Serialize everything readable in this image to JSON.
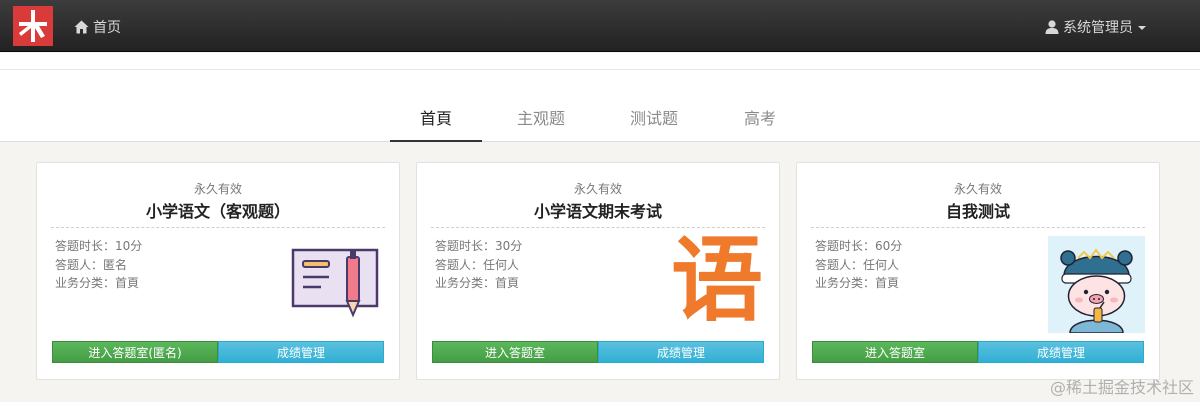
{
  "navbar": {
    "home_label": "首页",
    "user_label": "系统管理员",
    "icons": {
      "logo": "brand-logo",
      "home": "home-icon",
      "user": "user-icon",
      "caret": "caret-down-icon"
    }
  },
  "tabs": [
    {
      "label": "首頁",
      "active": true
    },
    {
      "label": "主观题",
      "active": false
    },
    {
      "label": "测试题",
      "active": false
    },
    {
      "label": "高考",
      "active": false
    }
  ],
  "cards": [
    {
      "validity": "永久有效",
      "title": "小学语文（客观题）",
      "info": [
        "答题时长：10分",
        "答题人：匿名",
        "业务分类：首頁"
      ],
      "enter_label": "进入答题室(匿名)",
      "score_label": "成绩管理",
      "art": "notebook-pen-icon"
    },
    {
      "validity": "永久有效",
      "title": "小学语文期末考试",
      "info": [
        "答题时长：30分",
        "答题人：任何人",
        "业务分类：首頁"
      ],
      "enter_label": "进入答题室",
      "score_label": "成绩管理",
      "art": "yu-character",
      "art_text": "语"
    },
    {
      "validity": "永久有效",
      "title": "自我测试",
      "info": [
        "答题时长：60分",
        "答题人：任何人",
        "业务分类：首頁"
      ],
      "enter_label": "进入答题室",
      "score_label": "成绩管理",
      "art": "pig-avatar-image"
    }
  ],
  "watermark": "@稀土掘金技术社区",
  "colors": {
    "navbar": "#2b2b2b",
    "green": "#4cae4c",
    "blue": "#46b8da",
    "art_orange": "#ef7a2c"
  }
}
